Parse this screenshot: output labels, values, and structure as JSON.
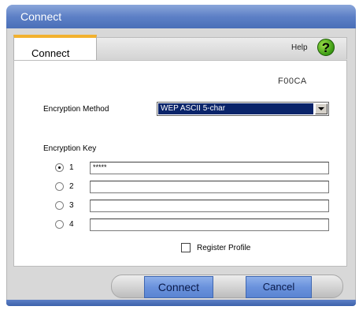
{
  "window": {
    "title": "Connect"
  },
  "tabs": [
    {
      "label": "Connect"
    }
  ],
  "help": {
    "label": "Help",
    "icon_glyph": "?",
    "icon": "help-question-icon",
    "icon_color": "#3a9a14"
  },
  "profile": {
    "name": "F00CA"
  },
  "encryption": {
    "method_label": "Encryption Method",
    "method_value": "WEP ASCII 5-char",
    "key_label": "Encryption Key",
    "keys": [
      {
        "index": "1",
        "value": "*****",
        "selected": true
      },
      {
        "index": "2",
        "value": "",
        "selected": false
      },
      {
        "index": "3",
        "value": "",
        "selected": false
      },
      {
        "index": "4",
        "value": "",
        "selected": false
      }
    ]
  },
  "register_profile": {
    "label": "Register Profile",
    "checked": false
  },
  "buttons": {
    "connect": "Connect",
    "cancel": "Cancel"
  },
  "colors": {
    "title_bar": "#5d80c6",
    "tab_accent": "#f2b12e",
    "button": "#6a92dc",
    "selection": "#0a246a"
  }
}
